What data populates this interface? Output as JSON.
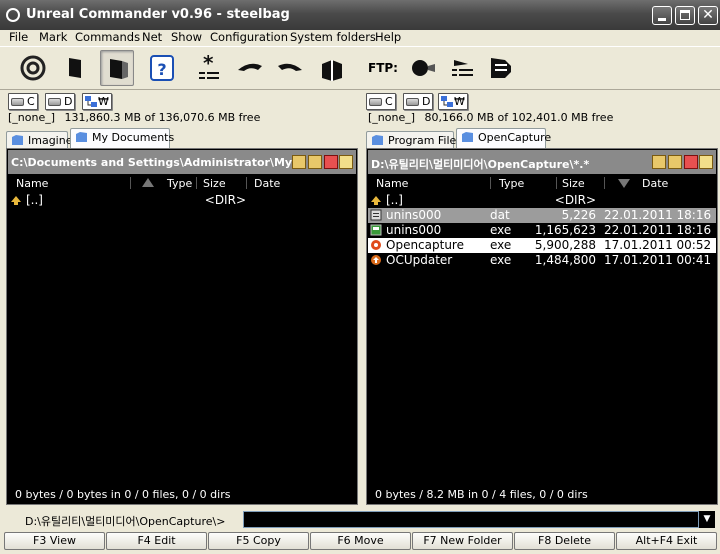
{
  "window": {
    "title": "Unreal Commander v0.96 - steelbag"
  },
  "menu": [
    "File",
    "Mark",
    "Commands",
    "Net",
    "Show",
    "Configuration",
    "System folders",
    "Help"
  ],
  "toolbar": {
    "ftp_label": "FTP:"
  },
  "left": {
    "drives": [
      "C",
      "D"
    ],
    "free_label": "[_none_]",
    "free_text": "131,860.3 MB of  136,070.6 MB free",
    "tabs": [
      "Imagine",
      "My Documents"
    ],
    "active_tab": 1,
    "path": "C:\\Documents and Settings\\Administrator\\My Documents\\*.*",
    "columns": [
      "Name",
      "Type",
      "Size",
      "Date"
    ],
    "rows": [
      {
        "name": "[..]",
        "type": "",
        "size": "<DIR>",
        "date": ""
      }
    ],
    "status": "0 bytes / 0 bytes in 0 / 0 files, 0 / 0 dirs"
  },
  "right": {
    "drives": [
      "C",
      "D"
    ],
    "free_label": "[_none_]",
    "free_text": "80,166.0 MB of  102,401.0 MB free",
    "tabs": [
      "Program Files",
      "OpenCapture"
    ],
    "active_tab": 1,
    "path": "D:\\유틸리티\\멀티미디어\\OpenCapture\\*.*",
    "columns": [
      "Name",
      "Type",
      "Size",
      "Date"
    ],
    "rows": [
      {
        "name": "[..]",
        "type": "",
        "size": "<DIR>",
        "date": ""
      },
      {
        "name": "unins000",
        "type": "dat",
        "size": "5,226",
        "date": "22.01.2011 18:16"
      },
      {
        "name": "unins000",
        "type": "exe",
        "size": "1,165,623",
        "date": "22.01.2011 18:16"
      },
      {
        "name": "Opencapture",
        "type": "exe",
        "size": "5,900,288",
        "date": "17.01.2011 00:52"
      },
      {
        "name": "OCUpdater",
        "type": "exe",
        "size": "1,484,800",
        "date": "17.01.2011 00:41"
      }
    ],
    "status": "0 bytes / 8.2 MB in 0 / 4 files, 0 / 0 dirs"
  },
  "cmdline": {
    "prompt": "D:\\유틸리티\\멀티미디어\\OpenCapture\\>"
  },
  "fkeys": [
    "F3 View",
    "F4 Edit",
    "F5 Copy",
    "F6 Move",
    "F7 New Folder",
    "F8 Delete",
    "Alt+F4 Exit"
  ]
}
